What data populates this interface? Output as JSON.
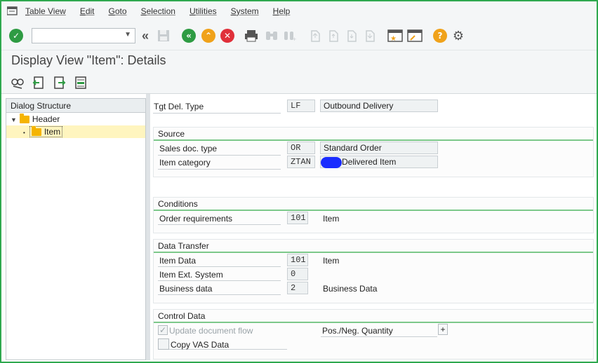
{
  "menu": [
    "Table View",
    "Edit",
    "Goto",
    "Selection",
    "Utilities",
    "System",
    "Help"
  ],
  "command_field": {
    "value": "",
    "placeholder": ""
  },
  "title": "Display View \"Item\": Details",
  "nav": {
    "header": "Dialog Structure",
    "items": [
      {
        "label": "Header"
      },
      {
        "label": "Item"
      }
    ]
  },
  "fields": {
    "tgt_del_type": {
      "label": "Tgt Del. Type",
      "code": "LF",
      "desc": "Outbound Delivery"
    }
  },
  "source": {
    "title": "Source",
    "sales_doc_type": {
      "label": "Sales doc. type",
      "code": "OR",
      "desc": "Standard Order"
    },
    "item_category": {
      "label": "Item category",
      "code": "ZTAN",
      "desc": "Delivered Item"
    }
  },
  "conditions": {
    "title": "Conditions",
    "order_requirements": {
      "label": "Order requirements",
      "code": "101",
      "desc": "Item"
    }
  },
  "data_transfer": {
    "title": "Data Transfer",
    "item_data": {
      "label": "Item Data",
      "code": "101",
      "desc": "Item"
    },
    "item_ext_system": {
      "label": "Item Ext. System",
      "code": "0"
    },
    "business_data": {
      "label": "Business data",
      "code": "2",
      "desc": "Business Data"
    }
  },
  "control_data": {
    "title": "Control Data",
    "update_doc_flow": {
      "label": "Update document flow",
      "checked": true
    },
    "pos_neg_quantity": {
      "label": "Pos./Neg. Quantity",
      "button": "+"
    },
    "copy_vas": {
      "label": "Copy VAS Data",
      "checked": false
    }
  },
  "colors": {
    "frame": "#2fa84f",
    "ok_green": "#2e9b43",
    "nav_green": "#2e9b43",
    "up_orange": "#f0a21a",
    "cancel_red": "#e0303a",
    "help_orange": "#f0a21a",
    "section_rule": "#7cc88a",
    "redaction": "#1a2cff"
  },
  "icons": {
    "toolbar": [
      "check-icon",
      "dropdown-icon",
      "double-chevron-left-icon",
      "save-icon",
      "back-icon",
      "exit-icon",
      "cancel-icon",
      "print-icon",
      "find-icon",
      "find-next-icon",
      "first-page-icon",
      "prev-page-icon",
      "next-page-icon",
      "last-page-icon",
      "new-session-icon",
      "shortcut-icon",
      "help-icon",
      "settings-gear-icon"
    ],
    "app_toolbar": [
      "display-change-icon",
      "previous-entry-icon",
      "next-entry-icon",
      "select-block-icon"
    ]
  }
}
